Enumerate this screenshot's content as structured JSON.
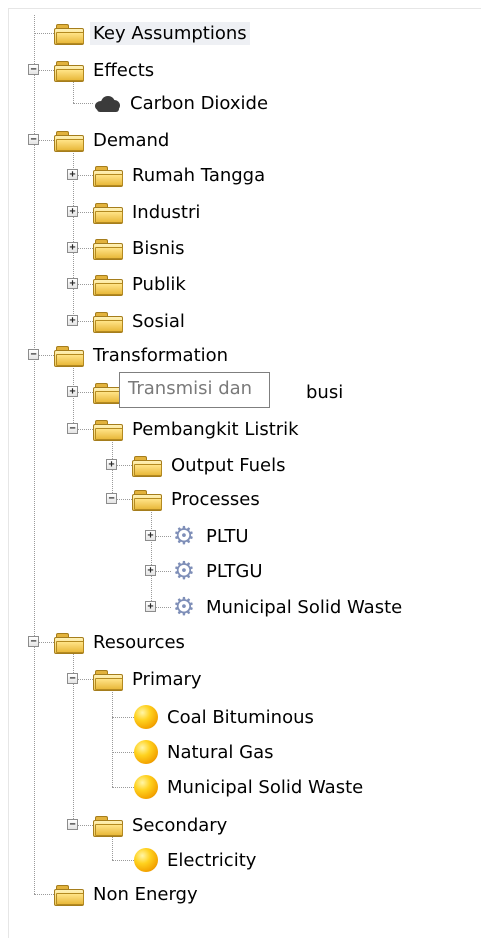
{
  "tree": {
    "key_assumptions": "Key Assumptions",
    "effects": {
      "label": "Effects",
      "carbon_dioxide": "Carbon Dioxide"
    },
    "demand": {
      "label": "Demand",
      "rumah_tangga": "Rumah Tangga",
      "industri": "Industri",
      "bisnis": "Bisnis",
      "publik": "Publik",
      "sosial": "Sosial"
    },
    "transformation": {
      "label": "Transformation",
      "transmisi_visible": "busi",
      "pembangkit": {
        "label": "Pembangkit Listrik",
        "output_fuels": "Output Fuels",
        "processes": {
          "label": "Processes",
          "pltu": "PLTU",
          "pltgu": "PLTGU",
          "msw": "Municipal Solid Waste"
        }
      }
    },
    "resources": {
      "label": "Resources",
      "primary": {
        "label": "Primary",
        "coal": "Coal Bituminous",
        "gas": "Natural Gas",
        "msw": "Municipal Solid Waste"
      },
      "secondary": {
        "label": "Secondary",
        "electricity": "Electricity"
      }
    },
    "non_energy": "Non Energy"
  },
  "tooltip": {
    "text": "Transmisi dan"
  },
  "icons": {
    "folder": "folder-icon",
    "resource": "yellow-circle-icon",
    "process": "gear-icon",
    "effect": "cloud-icon"
  },
  "toggles": {
    "expanded": "−",
    "collapsed": "+"
  }
}
